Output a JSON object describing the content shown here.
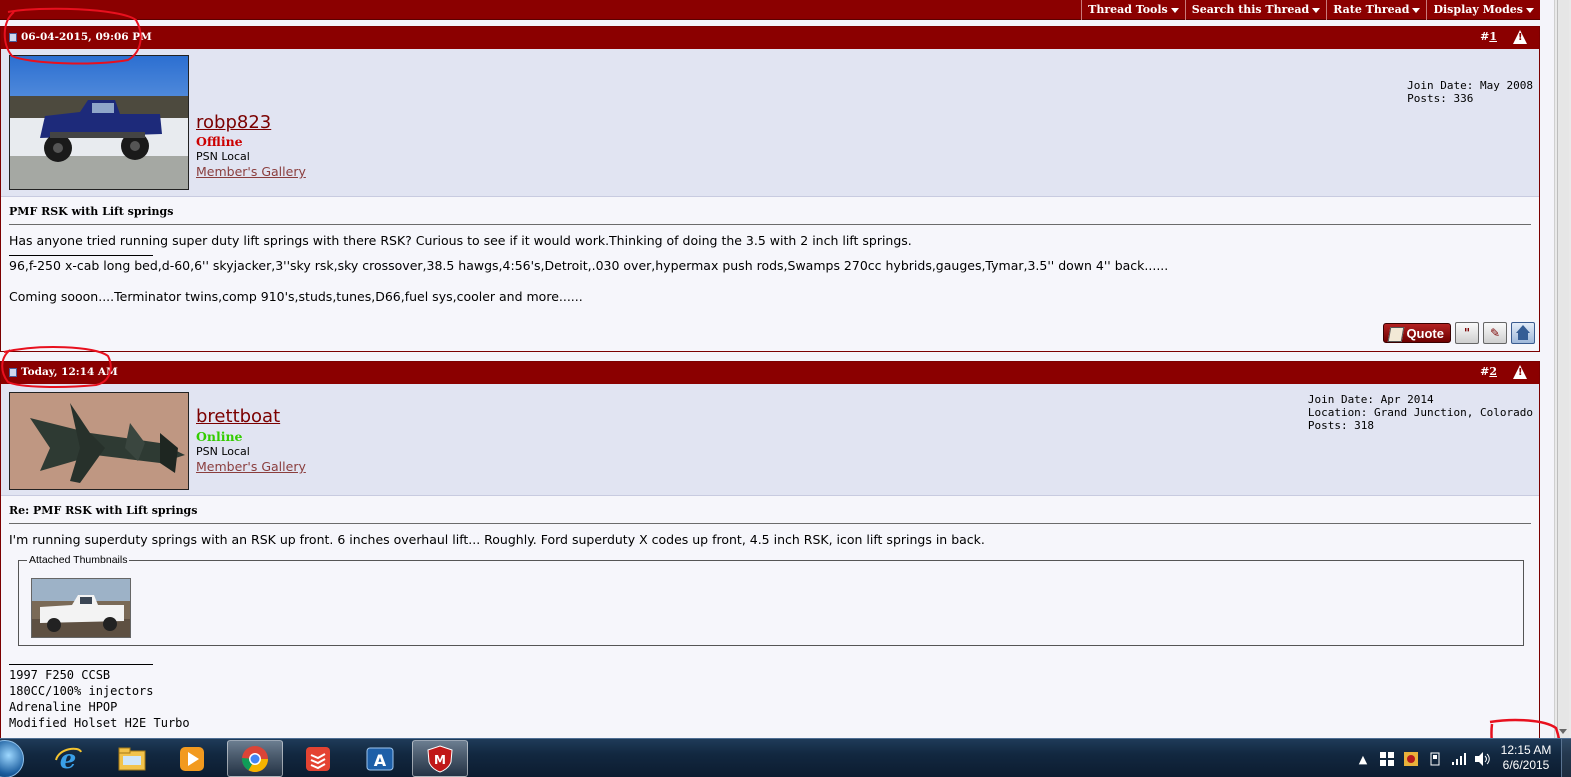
{
  "thread_tools": {
    "items": [
      "Thread Tools",
      "Search this Thread",
      "Rate Thread",
      "Display Modes"
    ]
  },
  "posts": [
    {
      "date": "06-04-2015, 09:06 PM",
      "num_prefix": "#",
      "num": "1",
      "username": "robp823",
      "status": "Offline",
      "status_color": "#cc0000",
      "user_title": "PSN Local",
      "gallery": "Member's Gallery",
      "info": [
        "Join Date: May 2008",
        "Posts: 336"
      ],
      "title": "PMF RSK with Lift springs",
      "message": "Has anyone tried running super duty lift springs with there RSK? Curious to see if it would work.Thinking of doing the 3.5 with 2 inch lift springs.",
      "signature": [
        "96,f-250 x-cab long bed,d-60,6'' skyjacker,3''sky rsk,sky crossover,38.5 hawgs,4:56's,Detroit,.030 over,hypermax push rods,Swamps 270cc hybrids,gauges,Tymar,3.5'' down 4'' back......",
        "Coming sooon....Terminator twins,comp 910's,studs,tunes,D66,fuel sys,cooler and more......"
      ],
      "quote_label": "Quote"
    },
    {
      "date": "Today, 12:14 AM",
      "num_prefix": "#",
      "num": "2",
      "username": "brettboat",
      "status": "Online",
      "status_color": "#33cc00",
      "user_title": "PSN Local",
      "gallery": "Member's Gallery",
      "info": [
        "Join Date: Apr 2014",
        "Location: Grand Junction, Colorado",
        "Posts: 318"
      ],
      "title": "Re: PMF RSK with Lift springs",
      "message": "I'm running superduty springs with an RSK up front. 6 inches overhaul lift... Roughly. Ford superduty X codes up front, 4.5 inch RSK, icon lift springs in back.",
      "attachments_legend": "Attached Thumbnails",
      "signature": [
        "1997 F250 CCSB",
        "180CC/100% injectors",
        "Adrenaline HPOP",
        "Modified Holset H2E Turbo"
      ]
    }
  ],
  "taskbar": {
    "apps": [
      "start-menu",
      "internet-explorer",
      "file-explorer",
      "media-player",
      "chrome",
      "todoist",
      "app-a",
      "mcafee"
    ],
    "clock_time": "12:15 AM",
    "clock_date": "6/6/2015"
  },
  "colors": {
    "header_red": "#8b0000",
    "user_row": "#e1e4f2",
    "annotation": "#e8101e"
  }
}
